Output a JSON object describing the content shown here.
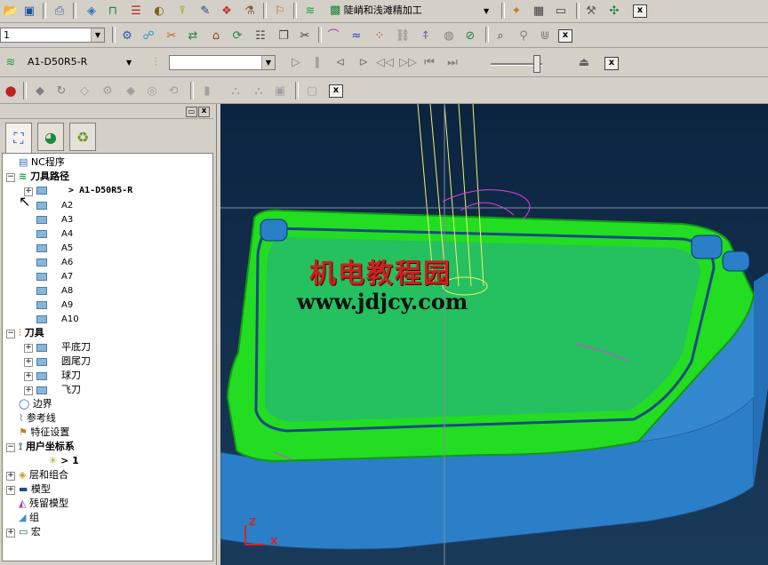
{
  "toolbar1": {
    "strategy_combo": "陡峭和浅滩精加工",
    "close_label": "x"
  },
  "toolbar2": {
    "level_combo": "1",
    "close_label": "x"
  },
  "toolbar3": {
    "toolpath_combo": "A1-D50R5-R",
    "tool_combo": "",
    "close_label": "x"
  },
  "toolbar4": {
    "close_label": "x"
  },
  "explorer": {
    "header_close": "x",
    "tabs": [
      "explorer-tab",
      "globe-tab",
      "recycle-tab"
    ],
    "tree": {
      "nc_programs": "NC程序",
      "toolpaths": "刀具路径",
      "active_toolpath": "> A1-D50R5-R",
      "toolpath_items": [
        "A2",
        "A3",
        "A4",
        "A5",
        "A6",
        "A7",
        "A8",
        "A9",
        "A10"
      ],
      "tools": "刀具",
      "tool_items": [
        "平底刀",
        "圆尾刀",
        "球刀",
        "飞刀"
      ],
      "boundaries": "边界",
      "reference_lines": "参考线",
      "feature_sets": "特征设置",
      "user_coord": "用户坐标系",
      "user_coord_item": "> 1",
      "levels": "层和组合",
      "models": "模型",
      "stock_models": "残留模型",
      "groups": "组",
      "macros": "宏"
    }
  },
  "viewport": {
    "watermark_title": "机电教程园",
    "watermark_url": "www.jdjcy.com",
    "axis_z": "Z",
    "axis_x": "X"
  },
  "colors": {
    "toolpath_green": "#22dd22",
    "model_blue": "#2a7fc8",
    "watermark_red": "#cc2020",
    "background": "#0f2a4a"
  }
}
